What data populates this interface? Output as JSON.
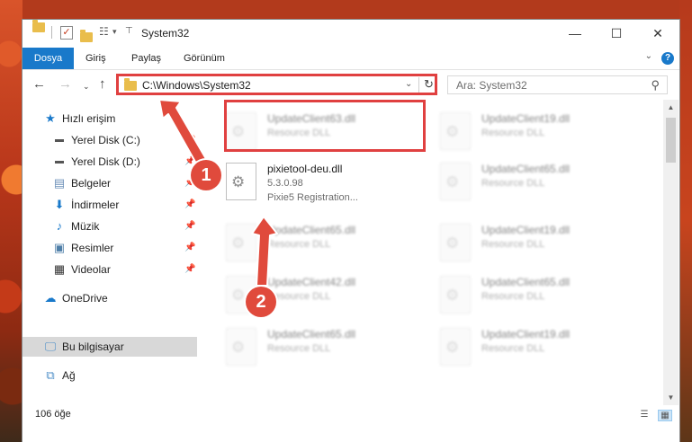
{
  "window": {
    "title": "System32"
  },
  "ribbon": {
    "tabs": [
      "Dosya",
      "Giriş",
      "Paylaş",
      "Görünüm"
    ],
    "help": "?"
  },
  "nav": {
    "address": "C:\\Windows\\System32",
    "search_placeholder": "Ara: System32"
  },
  "sidebar": {
    "items": [
      {
        "label": "Hızlı erişim",
        "icon": "star-icon"
      },
      {
        "label": "Yerel Disk (C:)",
        "icon": "drive-icon"
      },
      {
        "label": "Yerel Disk (D:)",
        "icon": "drive-icon"
      },
      {
        "label": "Belgeler",
        "icon": "document-icon"
      },
      {
        "label": "İndirmeler",
        "icon": "download-icon"
      },
      {
        "label": "Müzik",
        "icon": "music-icon"
      },
      {
        "label": "Resimler",
        "icon": "picture-icon"
      },
      {
        "label": "Videolar",
        "icon": "video-icon"
      },
      {
        "label": "OneDrive",
        "icon": "cloud-icon"
      },
      {
        "label": "Bu bilgisayar",
        "icon": "computer-icon"
      },
      {
        "label": "Ağ",
        "icon": "network-icon"
      }
    ]
  },
  "files": [
    {
      "name": "UpdateClient63.dll",
      "sub1": "Resource DLL",
      "sub2": ""
    },
    {
      "name": "UpdateClient19.dll",
      "sub1": "Resource DLL",
      "sub2": ""
    },
    {
      "name": "pixietool-deu.dll",
      "sub1": "5.3.0.98",
      "sub2": "Pixie5 Registration..."
    },
    {
      "name": "UpdateClient65.dll",
      "sub1": "Resource DLL",
      "sub2": ""
    },
    {
      "name": "UpdateClient65.dll",
      "sub1": "Resource DLL",
      "sub2": ""
    },
    {
      "name": "UpdateClient19.dll",
      "sub1": "Resource DLL",
      "sub2": ""
    },
    {
      "name": "UpdateClient42.dll",
      "sub1": "Resource DLL",
      "sub2": ""
    },
    {
      "name": "UpdateClient65.dll",
      "sub1": "Resource DLL",
      "sub2": ""
    },
    {
      "name": "UpdateClient65.dll",
      "sub1": "Resource DLL",
      "sub2": ""
    },
    {
      "name": "UpdateClient19.dll",
      "sub1": "Resource DLL",
      "sub2": ""
    }
  ],
  "status": {
    "count": "106 öğe"
  },
  "annotations": {
    "step1": "1",
    "step2": "2",
    "color": "#e04a3c"
  }
}
